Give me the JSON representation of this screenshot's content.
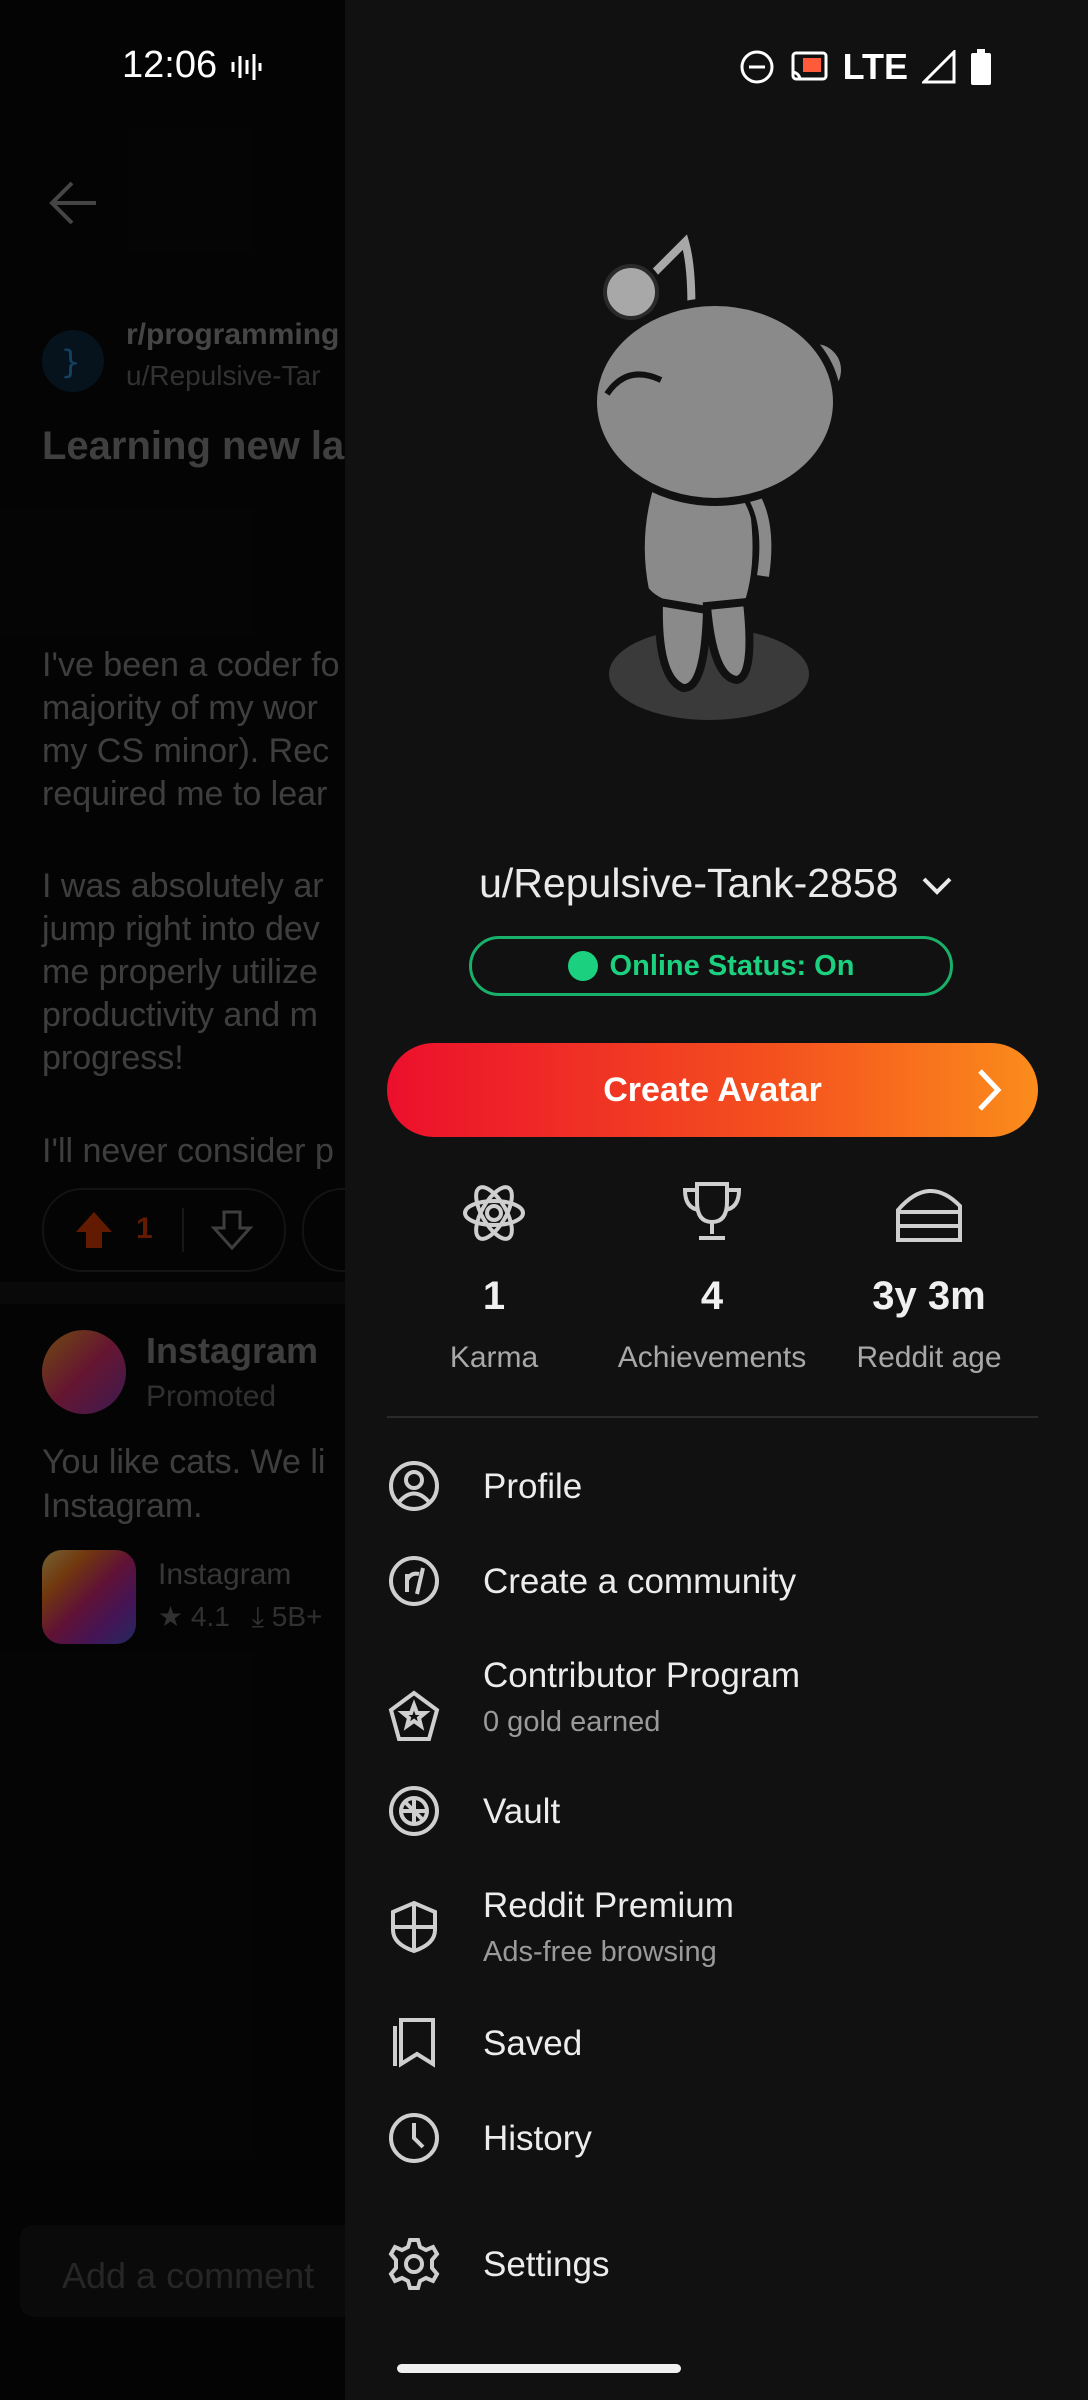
{
  "status_bar": {
    "time": "12:06",
    "network": "LTE"
  },
  "post": {
    "subreddit": "r/programming",
    "user": "u/Repulsive-Tar",
    "title": "Learning new la",
    "body_p1": "I've been a coder fo\nmajority of my wor\nmy CS minor). Rec\nrequired me to lear",
    "body_p2": "I was absolutely ar\njump right into dev\nme properly utilize\nproductivity and m\nprogress!",
    "body_p3": "I'll never consider p",
    "upvotes": "1"
  },
  "promoted": {
    "name": "Instagram",
    "tag": "Promoted",
    "text": "You like cats. We li\nInstagram.",
    "app_name": "Instagram",
    "rating": "4.1",
    "downloads": "5B+"
  },
  "comment_placeholder": "Add a comment",
  "drawer": {
    "username": "u/Repulsive-Tank-2858",
    "online_status": "Online Status: On",
    "create_avatar": "Create Avatar",
    "stats": [
      {
        "value": "1",
        "label": "Karma",
        "icon": "karma-icon"
      },
      {
        "value": "4",
        "label": "Achievements",
        "icon": "trophy-icon"
      },
      {
        "value": "3y 3m",
        "label": "Reddit age",
        "icon": "cake-icon"
      }
    ],
    "menu": [
      {
        "label": "Profile",
        "icon": "profile-icon"
      },
      {
        "label": "Create a community",
        "icon": "community-icon"
      },
      {
        "label": "Contributor Program",
        "sub": "0 gold earned",
        "icon": "contributor-icon"
      },
      {
        "label": "Vault",
        "icon": "vault-icon"
      },
      {
        "label": "Reddit Premium",
        "sub": "Ads-free browsing",
        "icon": "premium-icon"
      },
      {
        "label": "Saved",
        "icon": "saved-icon"
      },
      {
        "label": "History",
        "icon": "history-icon"
      },
      {
        "label": "Settings",
        "icon": "settings-icon"
      }
    ]
  },
  "colors": {
    "accent_start": "#ec0f2c",
    "accent_end": "#fb8c1c",
    "online": "#1bd17f",
    "drawer_bg": "#111111"
  }
}
